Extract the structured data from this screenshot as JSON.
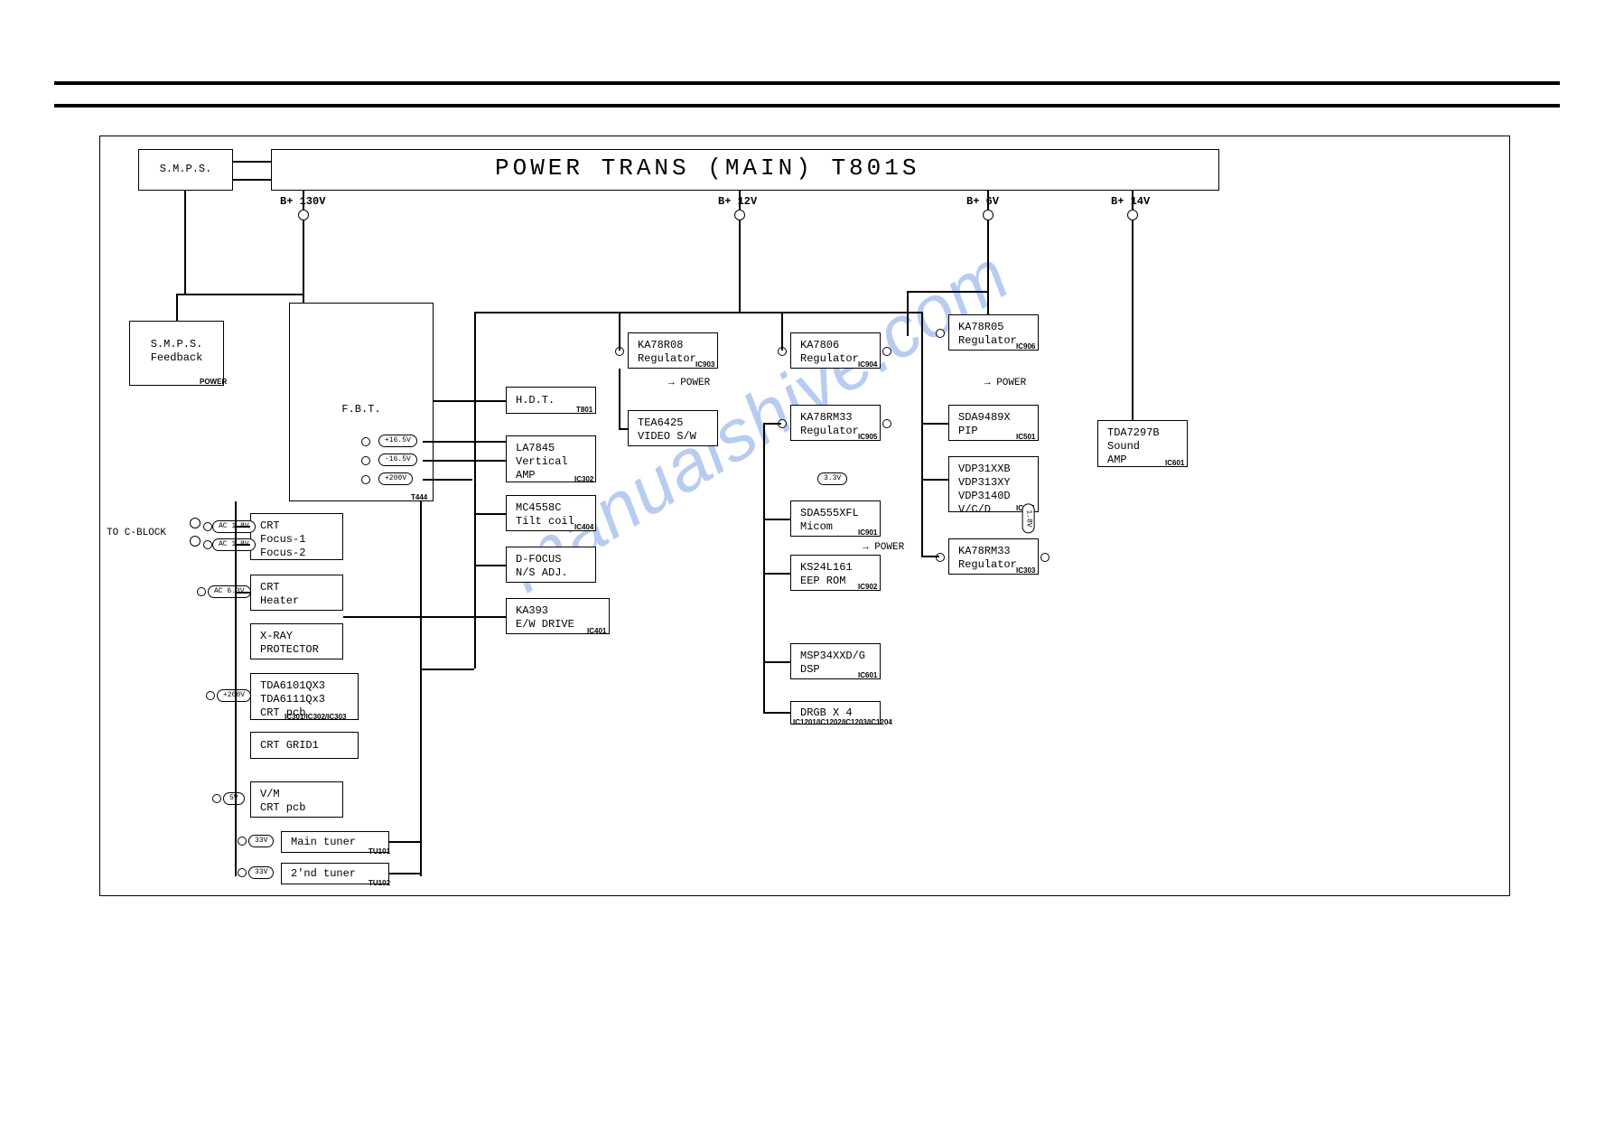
{
  "title": "POWER TRANS (MAIN) T801S",
  "taps": {
    "t1": "B+ 130V",
    "t2": "B+ 12V",
    "t3": "B+ 6V",
    "t4": "B+ 14V"
  },
  "left": {
    "smps": "S.M.P.S.",
    "feedback1": "S.M.P.S.",
    "feedback2": "Feedback",
    "toCblock": "TO C-BLOCK"
  },
  "blocks": {
    "fbt": "F.B.T.",
    "hdt": "H.D.T.",
    "la7845_1": "LA7845",
    "la7845_2": "Vertical",
    "la7845_3": "AMP",
    "mc4558_1": "MC4558C",
    "mc4558_2": "Tilt coil",
    "dfocus_1": "D-FOCUS",
    "dfocus_2": "N/S ADJ.",
    "ka393_1": "KA393",
    "ka393_2": "E/W DRIVE",
    "crtf_1": "CRT",
    "crtf_2": "Focus-1",
    "crtf_3": "Focus-2",
    "crth_1": "CRT",
    "crth_2": "Heater",
    "xray_1": "X-RAY",
    "xray_2": "PROTECTOR",
    "tda61_1": "TDA6101QX3",
    "tda61_2": "TDA6111Qx3",
    "tda61_3": "CRT pcb",
    "grid1": "CRT GRID1",
    "vm_1": "V/M",
    "vm_2": "CRT pcb",
    "tuner1": "Main tuner",
    "tuner2": "2'nd tuner",
    "ka78r08_1": "KA78R08",
    "ka78r08_2": "Regulator",
    "tea6425_1": "TEA6425",
    "tea6425_2": "VIDEO S/W",
    "ka7806_1": "KA7806",
    "ka7806_2": "Regulator",
    "ka78rm33a_1": "KA78RM33",
    "ka78rm33a_2": "Regulator",
    "sda555_1": "SDA555XFL",
    "sda555_2": "Micom",
    "ks24_1": "KS24L161",
    "ks24_2": "EEP ROM",
    "msp_1": "MSP34XXD/G",
    "msp_2": "DSP",
    "drgb": "DRGB X 4",
    "ka78r05_1": "KA78R05",
    "ka78r05_2": "Regulator",
    "sda9489_1": "SDA9489X",
    "sda9489_2": "PIP",
    "vdp_1": "VDP31XXB",
    "vdp_2": "VDP313XY",
    "vdp_3": "VDP3140D",
    "vdp_4": "V/C/D",
    "ka78rm33b_1": "KA78RM33",
    "ka78rm33b_2": "Regulator",
    "tda7297_1": "TDA7297B",
    "tda7297_2": "Sound",
    "tda7297_3": "AMP"
  },
  "pills": {
    "p16_5": "+16.5V",
    "pn16_5": "-16.5V",
    "p200": "+200V",
    "ac1": "AC 1.8V",
    "ac2": "AC 1.8V",
    "ac3": "AC 6.3V",
    "p200b": "+200V",
    "p3_3": "3.3V",
    "p1_8": "1.8V",
    "p5": "5V",
    "p33v": "33V",
    "p33vb": "33V",
    "p_pwr": "→ POWER",
    "p_pwr2": "→ POWER",
    "p_pwr3": "→ POWER"
  },
  "watermark": "manualshive.com",
  "refs": {
    "t801": "T801",
    "t444": "T444",
    "IC302": "IC302",
    "IC404": "IC404",
    "IC303": "IC303",
    "IC401": "IC401",
    "IC901": "IC901",
    "IC903": "IC903",
    "IC904": "IC904",
    "IC906": "IC906",
    "IC501": "IC501",
    "IC601": "IC601",
    "IC902": "IC902",
    "IC905": "IC905",
    "IC501b": "IC501",
    "crtpcb": "IC301/IC302/IC303",
    "drgbr": "IC1201/IC1202/IC1203/IC1204",
    "tu101": "TU101",
    "tu102": "TU102",
    "POWER1": "POWER"
  }
}
